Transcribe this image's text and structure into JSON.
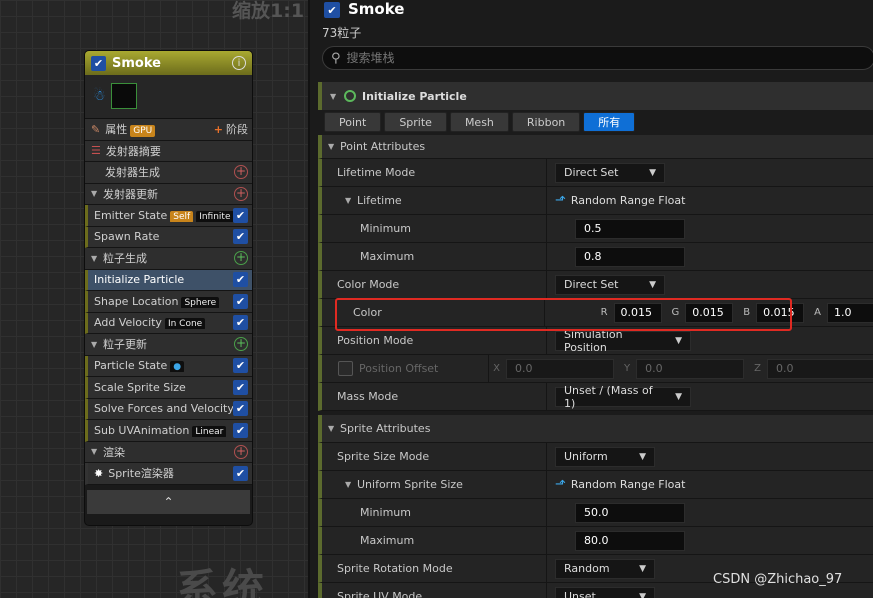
{
  "graph": {
    "zoom_label": "缩放1:1",
    "watermark": "系统"
  },
  "node": {
    "title": "Smoke",
    "rows": [
      {
        "type": "props",
        "label": "属性",
        "tag": "GPU",
        "action": "阶段"
      },
      {
        "type": "section",
        "label": "发射器摘要"
      },
      {
        "type": "sub",
        "label": "发射器生成"
      },
      {
        "type": "section",
        "label": "发射器更新"
      },
      {
        "type": "module",
        "label": "Emitter State",
        "tags": [
          "Self",
          "Infinite"
        ]
      },
      {
        "type": "module",
        "label": "Spawn Rate"
      },
      {
        "type": "section",
        "label": "粒子生成"
      },
      {
        "type": "module",
        "label": "Initialize Particle",
        "selected": true
      },
      {
        "type": "module",
        "label": "Shape Location",
        "tags": [
          "Sphere"
        ]
      },
      {
        "type": "module",
        "label": "Add Velocity",
        "tags": [
          "In Cone"
        ]
      },
      {
        "type": "section",
        "label": "粒子更新"
      },
      {
        "type": "module",
        "label": "Particle State"
      },
      {
        "type": "module",
        "label": "Scale Sprite Size"
      },
      {
        "type": "module",
        "label": "Solve Forces and Velocity"
      },
      {
        "type": "module",
        "label": "Sub UVAnimation",
        "tags": [
          "Linear"
        ]
      },
      {
        "type": "section",
        "label": "渲染"
      },
      {
        "type": "module",
        "label": "Sprite渲染器"
      }
    ]
  },
  "panel": {
    "title": "Smoke",
    "subtitle": "73粒子",
    "search_placeholder": "搜索堆栈",
    "section_title": "Initialize Particle",
    "tabs": [
      "Point",
      "Sprite",
      "Mesh",
      "Ribbon",
      "所有"
    ],
    "active_tab": "所有",
    "point_attributes": {
      "header": "Point Attributes",
      "lifetime_mode_label": "Lifetime Mode",
      "lifetime_mode": "Direct Set",
      "lifetime_label": "Lifetime",
      "lifetime_value": "Random Range Float",
      "minimum_label": "Minimum",
      "minimum": "0.5",
      "maximum_label": "Maximum",
      "maximum": "0.8",
      "color_mode_label": "Color Mode",
      "color_mode": "Direct Set",
      "color_label": "Color",
      "color": {
        "r": "0.015",
        "g": "0.015",
        "b": "0.015",
        "a": "1.0"
      },
      "position_mode_label": "Position Mode",
      "position_mode": "Simulation Position",
      "position_offset_label": "Position Offset",
      "position_offset": {
        "x": "0.0",
        "y": "0.0",
        "z": "0.0"
      },
      "mass_mode_label": "Mass Mode",
      "mass_mode": "Unset / (Mass of 1)"
    },
    "sprite_attributes": {
      "header": "Sprite Attributes",
      "size_mode_label": "Sprite Size Mode",
      "size_mode": "Uniform",
      "uniform_size_label": "Uniform Sprite Size",
      "uniform_size_value": "Random Range Float",
      "minimum_label": "Minimum",
      "minimum": "50.0",
      "maximum_label": "Maximum",
      "maximum": "80.0",
      "rotation_mode_label": "Sprite Rotation Mode",
      "rotation_mode": "Random",
      "uv_mode_label": "Sprite UV Mode",
      "uv_mode": "Unset"
    }
  },
  "watermark": "CSDN @Zhichao_97",
  "colors": {
    "selection": "#3e5168",
    "highlight": "#e02a22",
    "accent": "#0f6fd6",
    "node_header": "#a9a931"
  }
}
